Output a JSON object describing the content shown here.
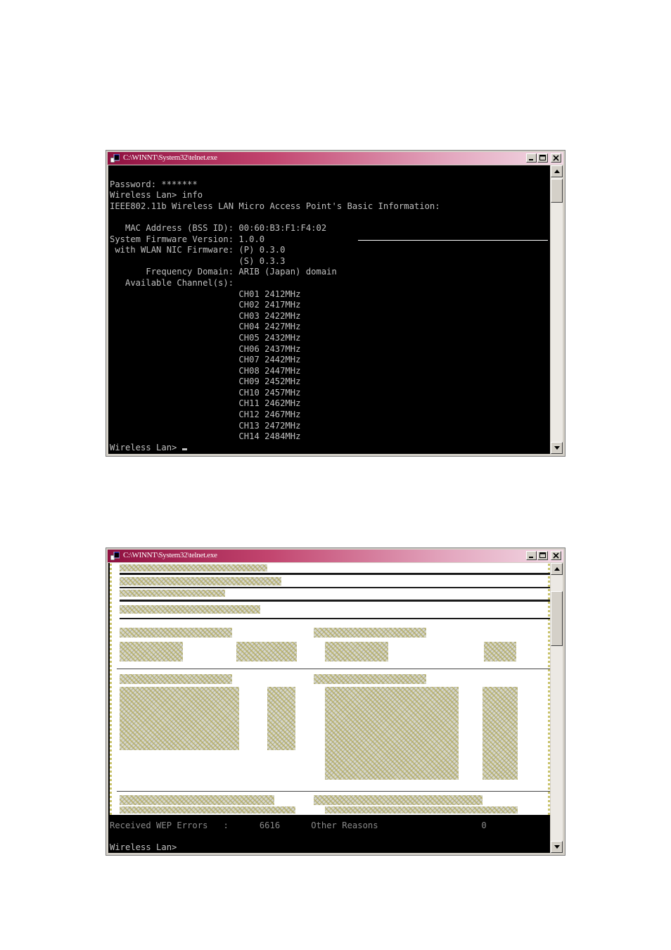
{
  "window1": {
    "title": "C:\\WINNT\\System32\\telnet.exe",
    "console_lines": [
      "",
      "Password: *******",
      "Wireless Lan> info",
      "IEEE802.11b Wireless LAN Micro Access Point's Basic Information:",
      "",
      "   MAC Address (BSS ID): 00:60:B3:F1:F4:02",
      "System Firmware Version: 1.0.0",
      " with WLAN NIC Firmware: (P) 0.3.0",
      "                         (S) 0.3.3",
      "       Frequency Domain: ARIB (Japan) domain",
      "   Available Channel(s):",
      "                         CH01 2412MHz",
      "                         CH02 2417MHz",
      "                         CH03 2422MHz",
      "                         CH04 2427MHz",
      "                         CH05 2432MHz",
      "                         CH06 2437MHz",
      "                         CH07 2442MHz",
      "                         CH08 2447MHz",
      "                         CH09 2452MHz",
      "                         CH10 2457MHz",
      "                         CH11 2462MHz",
      "                         CH12 2467MHz",
      "                         CH13 2472MHz",
      "                         CH14 2484MHz"
    ],
    "prompt": "Wireless Lan> "
  },
  "window2": {
    "title": "C:\\WINNT\\System32\\telnet.exe",
    "partial_line": {
      "left": "Received WEP Errors",
      "colon": ":",
      "value": "6616",
      "right": "Other Reasons",
      "right_value": "0"
    },
    "prompt": "Wireless Lan>"
  },
  "colors": {
    "console_bg": "#000000",
    "console_text": "#c0c0c0",
    "title_start": "#8f1040",
    "title_end": "#f3dbe6",
    "chrome": "#d4d0c8"
  },
  "icons": [
    "console-app-icon",
    "minimize-icon",
    "maximize-icon",
    "close-icon",
    "scroll-up-arrow-icon",
    "scroll-down-arrow-icon"
  ]
}
